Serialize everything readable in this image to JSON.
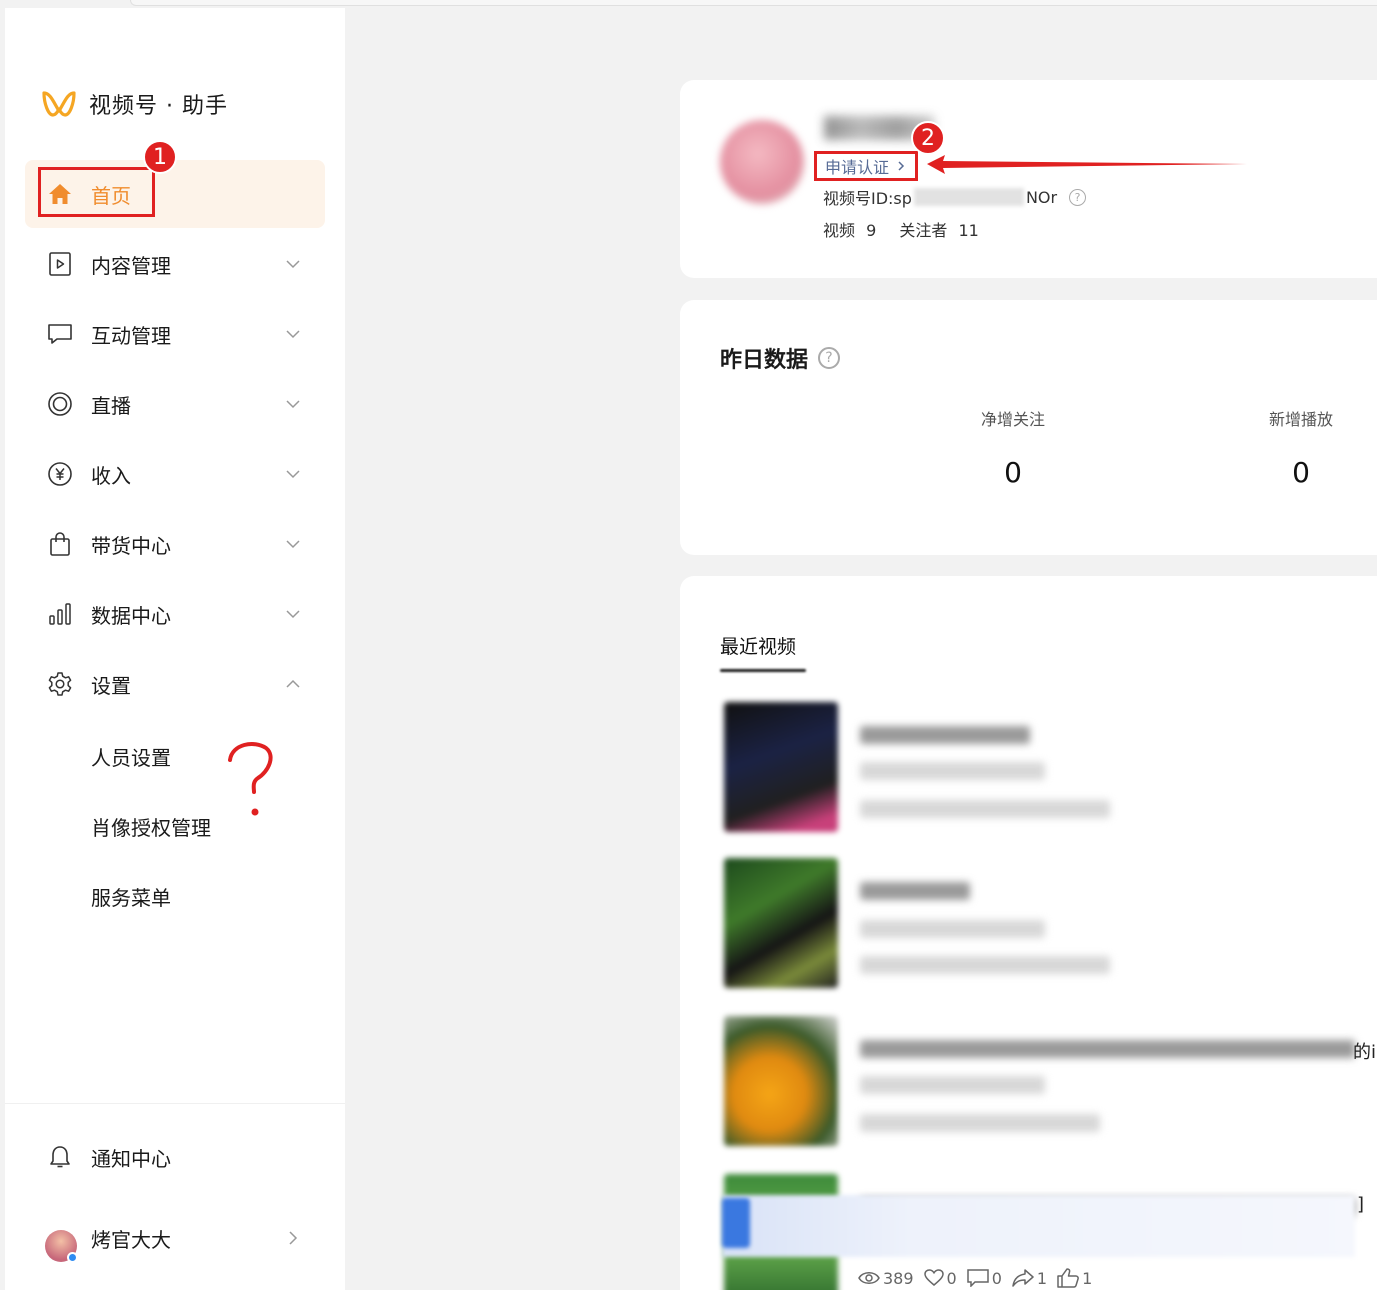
{
  "app": {
    "name": "视频号 · 助手"
  },
  "sidebar": {
    "items": [
      {
        "label": "首页",
        "icon": "home-icon",
        "active": true
      },
      {
        "label": "内容管理",
        "icon": "play-square-icon"
      },
      {
        "label": "互动管理",
        "icon": "chat-bubble-icon"
      },
      {
        "label": "直播",
        "icon": "live-ring-icon"
      },
      {
        "label": "收入",
        "icon": "yuan-icon"
      },
      {
        "label": "带货中心",
        "icon": "shopping-bag-icon"
      },
      {
        "label": "数据中心",
        "icon": "bar-chart-icon"
      },
      {
        "label": "设置",
        "icon": "gear-icon",
        "expanded": true
      }
    ],
    "settings_sub": [
      "人员设置",
      "肖像授权管理",
      "服务菜单"
    ],
    "bottom": {
      "notify_label": "通知中心",
      "user_name": "烤官大大"
    }
  },
  "annotations": {
    "badge1": "1",
    "badge2": "2",
    "question": "?"
  },
  "profile": {
    "verify_label": "申请认证",
    "id_prefix": "视频号ID:sp",
    "id_suffix": "NOr",
    "videos_label": "视频",
    "videos_count": "9",
    "followers_label": "关注者",
    "followers_count": "11"
  },
  "yesterday": {
    "title": "昨日数据",
    "net_follow_label": "净增关注",
    "net_follow_value": "0",
    "new_play_label": "新增播放",
    "new_play_value": "0"
  },
  "recent": {
    "tab_title": "最近视频",
    "edge_text_1": "的i",
    "edge_text_2": "]",
    "last_stats": {
      "views": "389",
      "likes": "0",
      "comments": "0",
      "shares": "1",
      "thumbs": "1"
    }
  },
  "colors": {
    "accent": "#f08c2e",
    "link": "#576b95",
    "annotation": "#e02121"
  }
}
